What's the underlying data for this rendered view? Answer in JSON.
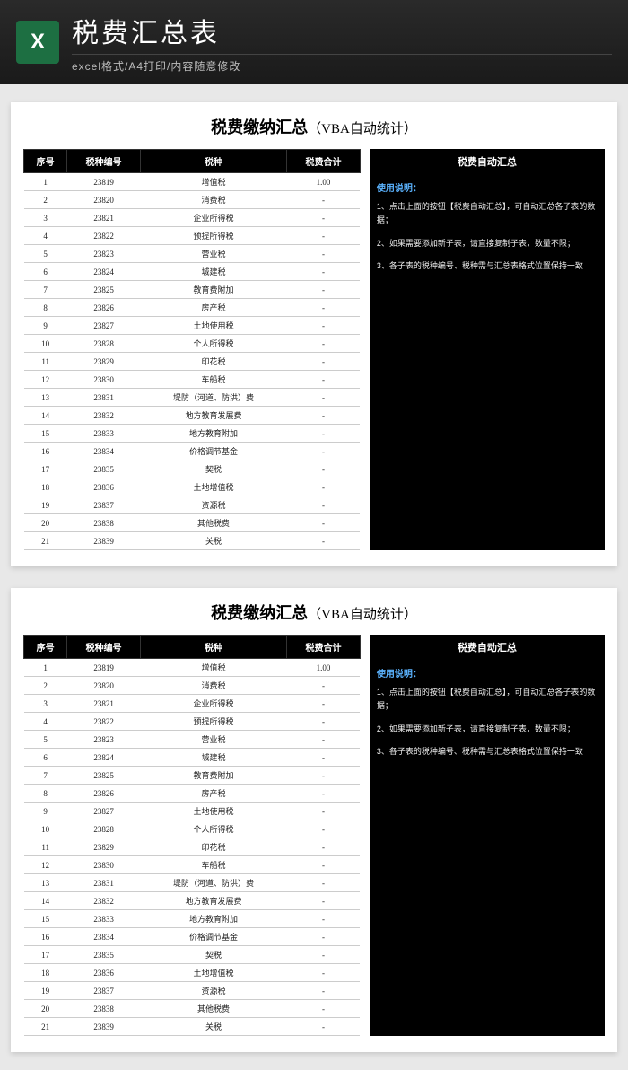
{
  "header": {
    "title": "税费汇总表",
    "subtitle": "excel格式/A4打印/内容随意修改",
    "icon_label": "Excel"
  },
  "sheet": {
    "title_main": "税费缴纳汇总",
    "title_sub": "（VBA自动统计）",
    "columns": [
      "序号",
      "税种编号",
      "税种",
      "税费合计"
    ],
    "rows": [
      {
        "seq": "1",
        "code": "23819",
        "name": "增值税",
        "total": "1.00"
      },
      {
        "seq": "2",
        "code": "23820",
        "name": "消费税",
        "total": "-"
      },
      {
        "seq": "3",
        "code": "23821",
        "name": "企业所得税",
        "total": "-"
      },
      {
        "seq": "4",
        "code": "23822",
        "name": "预提所得税",
        "total": "-"
      },
      {
        "seq": "5",
        "code": "23823",
        "name": "营业税",
        "total": "-"
      },
      {
        "seq": "6",
        "code": "23824",
        "name": "城建税",
        "total": "-"
      },
      {
        "seq": "7",
        "code": "23825",
        "name": "教育费附加",
        "total": "-"
      },
      {
        "seq": "8",
        "code": "23826",
        "name": "房产税",
        "total": "-"
      },
      {
        "seq": "9",
        "code": "23827",
        "name": "土地使用税",
        "total": "-"
      },
      {
        "seq": "10",
        "code": "23828",
        "name": "个人所得税",
        "total": "-"
      },
      {
        "seq": "11",
        "code": "23829",
        "name": "印花税",
        "total": "-"
      },
      {
        "seq": "12",
        "code": "23830",
        "name": "车船税",
        "total": "-"
      },
      {
        "seq": "13",
        "code": "23831",
        "name": "堤防（河道、防洪）费",
        "total": "-"
      },
      {
        "seq": "14",
        "code": "23832",
        "name": "地方教育发展费",
        "total": "-"
      },
      {
        "seq": "15",
        "code": "23833",
        "name": "地方教育附加",
        "total": "-"
      },
      {
        "seq": "16",
        "code": "23834",
        "name": "价格调节基金",
        "total": "-"
      },
      {
        "seq": "17",
        "code": "23835",
        "name": "契税",
        "total": "-"
      },
      {
        "seq": "18",
        "code": "23836",
        "name": "土地增值税",
        "total": "-"
      },
      {
        "seq": "19",
        "code": "23837",
        "name": "资源税",
        "total": "-"
      },
      {
        "seq": "20",
        "code": "23838",
        "name": "其他税费",
        "total": "-"
      },
      {
        "seq": "21",
        "code": "23839",
        "name": "关税",
        "total": "-"
      }
    ],
    "panel": {
      "header": "税费自动汇总",
      "instructions_label": "使用说明：",
      "items": [
        "1、点击上面的按钮【税费自动汇总】，可自动汇总各子表的数据；",
        "2、如果需要添加新子表，请直接复制子表，数量不限；",
        "3、各子表的税种编号、税种需与汇总表格式位置保持一致"
      ]
    }
  }
}
